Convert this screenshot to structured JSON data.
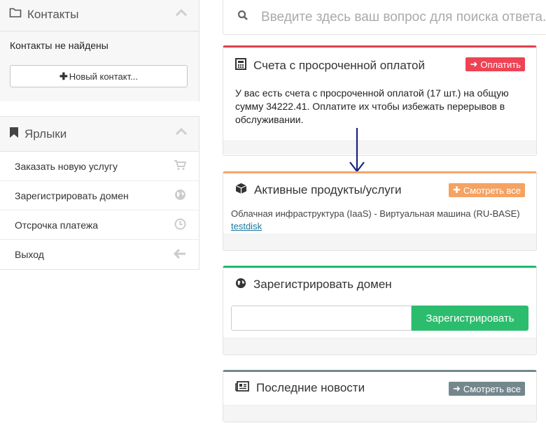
{
  "colors": {
    "danger": "#e0404c",
    "warning": "#f4a56c",
    "success": "#2bbd6d",
    "news": "#74878c"
  },
  "sidebar": {
    "contacts": {
      "title": "Контакты",
      "empty": "Контакты не найдены",
      "new_button": "Новый контакт..."
    },
    "shortcuts": {
      "title": "Ярлыки",
      "items": [
        {
          "label": "Заказать новую услугу",
          "icon": "cart-icon"
        },
        {
          "label": "Зарегистрировать домен",
          "icon": "globe-icon"
        },
        {
          "label": "Отсрочка платежа",
          "icon": "clock-icon"
        },
        {
          "label": "Выход",
          "icon": "arrow-left-icon"
        }
      ]
    }
  },
  "search": {
    "placeholder": "Введите здесь ваш вопрос для поиска ответа..."
  },
  "overdue": {
    "title": "Счета с просроченной оплатой",
    "button": "Оплатить",
    "text": "У вас есть счета с просроченной оплатой (17 шт.) на общую сумму 34222.41. Оплатите их чтобы избежать перерывов в обслуживании."
  },
  "products": {
    "title": "Активные продукты/услуги",
    "button": "Смотреть все",
    "item_desc": "Облачная инфраструктура (IaaS) - Виртуальная машина (RU-BASE)",
    "item_link": "testdisk"
  },
  "domain": {
    "title": "Зарегистрировать домен",
    "input_value": "",
    "button": "Зарегистрировать"
  },
  "news": {
    "title": "Последние новости",
    "button": "Смотреть все"
  }
}
